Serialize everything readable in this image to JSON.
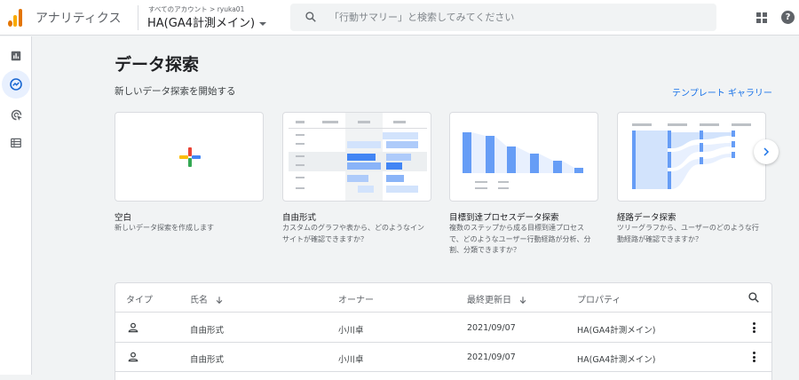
{
  "header": {
    "app_name": "アナリティクス",
    "breadcrumb": "すべてのアカウント > ryuka01",
    "property": "HA(GA4計測メイン)",
    "search_placeholder": "「行動サマリー」と検索してみてください"
  },
  "sidenav": {
    "items": [
      {
        "icon": "bar-chart-icon",
        "active": false
      },
      {
        "icon": "explore-icon",
        "active": true
      },
      {
        "icon": "advertising-icon",
        "active": false
      },
      {
        "icon": "list-icon",
        "active": false
      }
    ]
  },
  "main": {
    "title": "データ探索",
    "section_label": "新しいデータ探索を開始する",
    "gallery_link": "テンプレート ギャラリー",
    "cards": [
      {
        "title": "空白",
        "description": "新しいデータ探索を作成します"
      },
      {
        "title": "自由形式",
        "description": "カスタムのグラフや表から、どのようなインサイトが確認できますか？"
      },
      {
        "title": "目標到達プロセスデータ探索",
        "description": "複数のステップから成る目標到達プロセスで、どのようなユーザー行動経路が分析、分割、分類できますか？"
      },
      {
        "title": "経路データ探索",
        "description": "ツリーグラフから、ユーザーのどのような行動経路が確認できますか？"
      }
    ]
  },
  "table": {
    "headers": {
      "type": "タイプ",
      "name": "氏名",
      "owner": "オーナー",
      "updated": "最終更新日",
      "property": "プロパティ"
    },
    "rows": [
      {
        "name": "自由形式",
        "owner": "小川卓",
        "updated": "2021/09/07",
        "property": "HA(GA4計測メイン)"
      },
      {
        "name": "自由形式",
        "owner": "小川卓",
        "updated": "2021/09/07",
        "property": "HA(GA4計測メイン)"
      }
    ]
  },
  "colors": {
    "accent": "#1a73e8",
    "logo_orange": "#f9ab00",
    "logo_dark_orange": "#e37400"
  }
}
